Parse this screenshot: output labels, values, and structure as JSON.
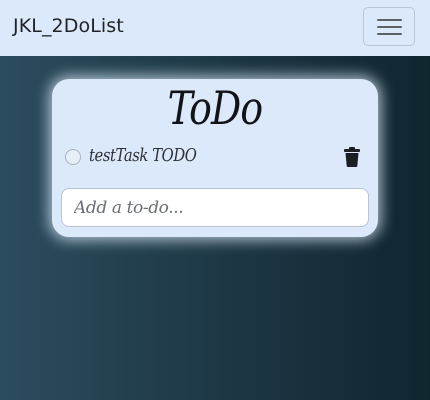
{
  "navbar": {
    "brand": "JKL_2DoList",
    "toggle_icon": "hamburger-menu-icon"
  },
  "todo_card": {
    "title": "ToDo",
    "items": [
      {
        "text": "testTask TODO",
        "checked": false,
        "check_icon": "circle-radio-icon",
        "delete_icon": "trash-icon"
      }
    ],
    "input": {
      "value": "",
      "placeholder": "Add a to-do..."
    }
  },
  "colors": {
    "navbar_bg": "#dbe9fa",
    "card_bg": "#dbe9fa",
    "background_left": "#2b4c5f",
    "background_right": "#10262f",
    "text_dark": "#111417"
  }
}
